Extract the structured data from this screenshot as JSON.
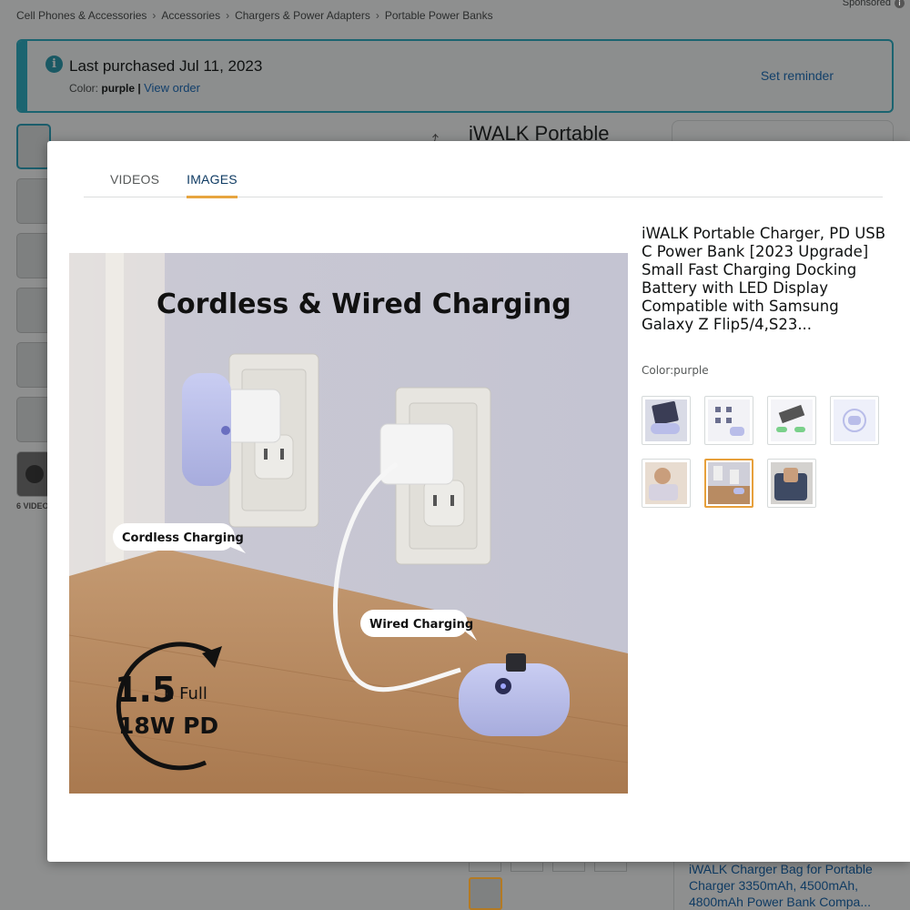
{
  "breadcrumb": [
    "Cell Phones & Accessories",
    "Accessories",
    "Chargers & Power Adapters",
    "Portable Power Banks"
  ],
  "breadcrumb_sep": "›",
  "sponsored": "Sponsored",
  "purchase_notice": {
    "title": "Last purchased Jul 11, 2023",
    "color_label": "Color:",
    "color_value": "purple",
    "divider": "|",
    "view_order": "View order",
    "set_reminder": "Set reminder"
  },
  "background": {
    "title_fragment": "iWALK Portable",
    "videos_count_label": "6 VIDEO",
    "related_link": "iWALK Charger Bag for Portable Charger 3350mAh, 4500mAh, 4800mAh Power Bank Compa..."
  },
  "modal": {
    "tabs": [
      {
        "label": "VIDEOS",
        "active": false
      },
      {
        "label": "IMAGES",
        "active": true
      }
    ],
    "product_title": "iWALK Portable Charger, PD USB C Power Bank [2023 Upgrade] Small Fast Charging Docking Battery with LED Display Compatible with Samsung Galaxy Z Flip5/4,S23...",
    "color_line": "Color:purple",
    "main_image": {
      "headline": "Cordless & Wired Charging",
      "bubble_cordless": "Cordless Charging",
      "bubble_wired": "Wired Charging",
      "badge_number": "1.5",
      "badge_unit": "h Full",
      "badge_power": "18W PD"
    },
    "thumbnails": [
      {
        "name": "thumb-1",
        "selected": false
      },
      {
        "name": "thumb-2",
        "selected": false
      },
      {
        "name": "thumb-3",
        "selected": false
      },
      {
        "name": "thumb-4",
        "selected": false
      },
      {
        "name": "thumb-5",
        "selected": false
      },
      {
        "name": "thumb-6",
        "selected": true
      },
      {
        "name": "thumb-7",
        "selected": false
      }
    ]
  },
  "colors": {
    "accent_tab": "#e7a540",
    "link": "#0f3b63",
    "selected_thumb_border": "#e7a03b",
    "notice_border": "#1b6470"
  }
}
